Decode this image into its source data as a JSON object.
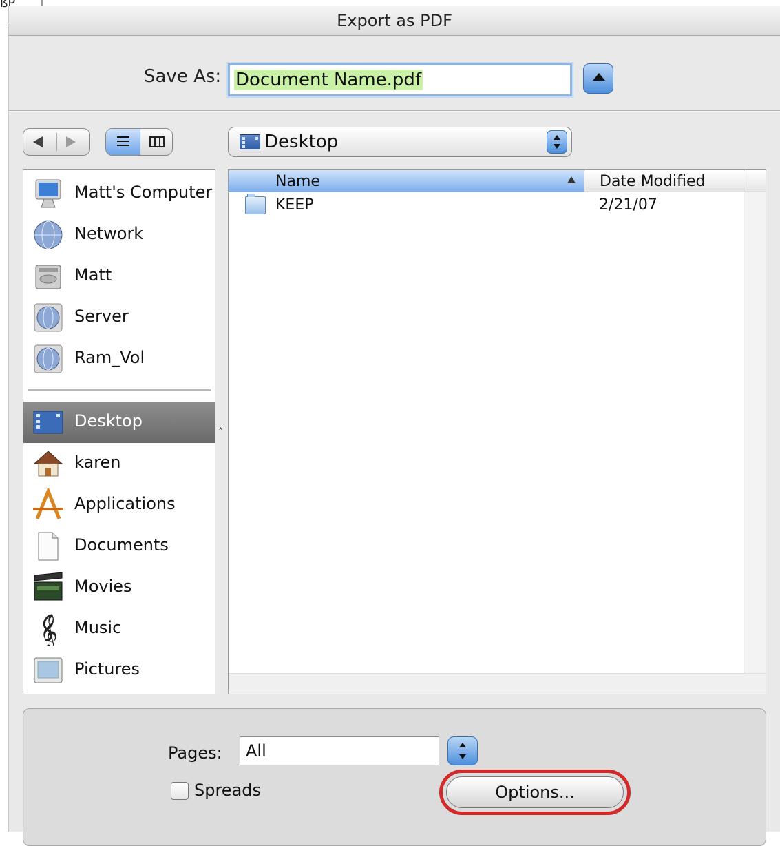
{
  "background_fragment": {
    "text": "ßP"
  },
  "dialog": {
    "title": "Export as PDF",
    "save_as_label": "Save As:",
    "save_as_value": "Document Name.pdf",
    "location": "Desktop"
  },
  "sidebar": {
    "devices": [
      {
        "label": "Matt's Computer",
        "icon": "computer-icon"
      },
      {
        "label": "Network",
        "icon": "network-globe-icon"
      },
      {
        "label": "Matt",
        "icon": "hard-drive-icon"
      },
      {
        "label": "Server",
        "icon": "server-globe-icon"
      },
      {
        "label": "Ram_Vol",
        "icon": "volume-globe-icon"
      }
    ],
    "places": [
      {
        "label": "Desktop",
        "icon": "desktop-icon",
        "selected": true
      },
      {
        "label": "karen",
        "icon": "home-icon"
      },
      {
        "label": "Applications",
        "icon": "applications-icon"
      },
      {
        "label": "Documents",
        "icon": "documents-icon"
      },
      {
        "label": "Movies",
        "icon": "movies-icon"
      },
      {
        "label": "Music",
        "icon": "music-icon"
      },
      {
        "label": "Pictures",
        "icon": "pictures-icon"
      }
    ]
  },
  "file_list": {
    "columns": [
      "Name",
      "Date Modified"
    ],
    "sort": "Name ascending",
    "rows": [
      {
        "name": "KEEP",
        "date": "2/21/07",
        "icon": "folder-icon"
      }
    ]
  },
  "options_panel": {
    "pages_label": "Pages:",
    "pages_value": "All",
    "spreads_label": "Spreads",
    "spreads_checked": false,
    "options_button": "Options..."
  },
  "colors": {
    "accent_blue": "#4d8fdc",
    "selection_green": "#c9f2a6",
    "highlight_red": "#d12a2a",
    "sidebar_selected": "#7a7a7a"
  }
}
